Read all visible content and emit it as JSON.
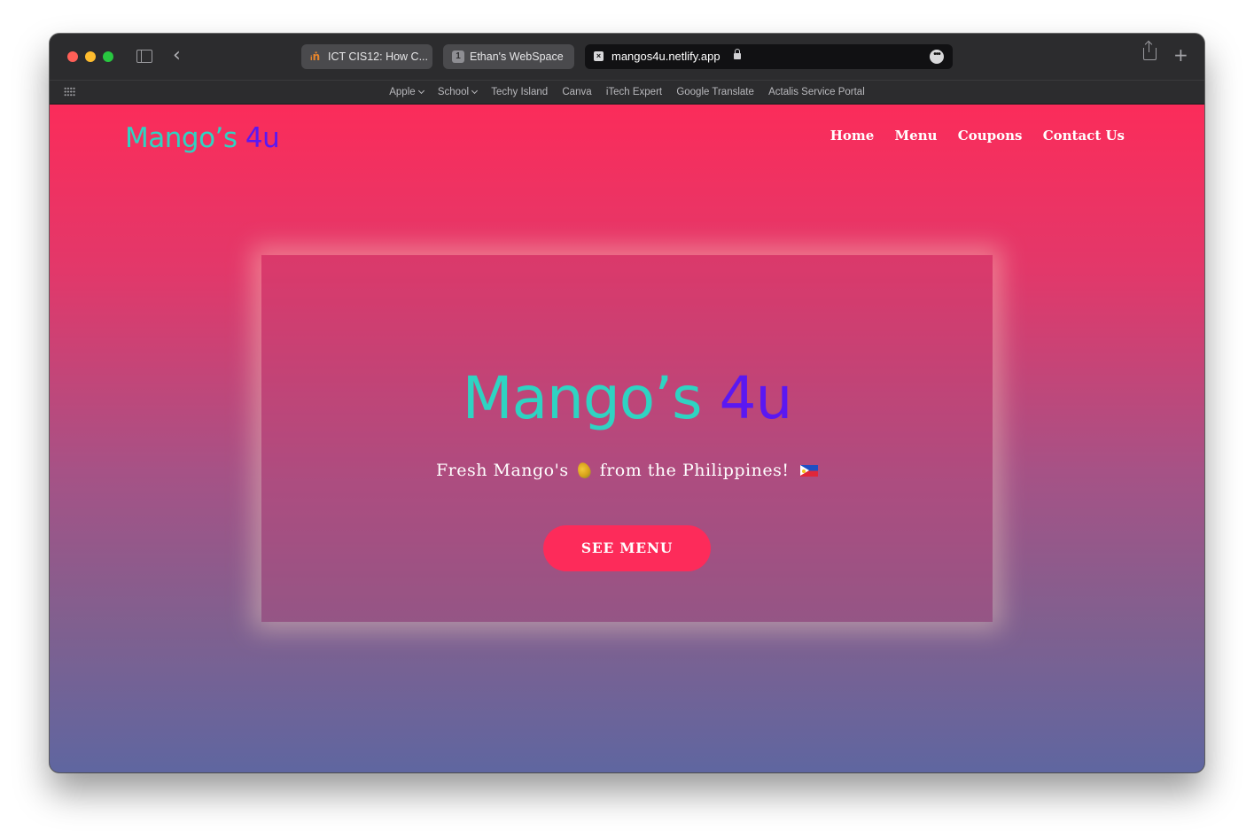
{
  "browser": {
    "tabs": [
      {
        "label": "ICT CIS12: How C...",
        "favicon": "moodle-icon"
      },
      {
        "label": "Ethan's WebSpace",
        "favicon": "tab-group-icon",
        "favicon_text": "1"
      }
    ],
    "address": {
      "url": "mangos4u.netlify.app",
      "secure": true
    },
    "bookmarks": [
      {
        "label": "Apple",
        "has_menu": true
      },
      {
        "label": "School",
        "has_menu": true
      },
      {
        "label": "Techy Island"
      },
      {
        "label": "Canva"
      },
      {
        "label": "iTech Expert"
      },
      {
        "label": "Google Translate"
      },
      {
        "label": "Actalis Service Portal"
      }
    ]
  },
  "site": {
    "logo": {
      "part1": "Mango’s",
      "part2": "4u"
    },
    "nav": [
      "Home",
      "Menu",
      "Coupons",
      "Contact Us"
    ],
    "hero": {
      "title_part1": "Mango’s",
      "title_part2": "4u",
      "subtitle_before": "Fresh Mango's",
      "subtitle_after": "from the Philippines!",
      "cta_label": "SEE MENU"
    }
  },
  "colors": {
    "brand_teal": "#2fd3c2",
    "brand_purple": "#5a18f2",
    "accent_pink": "#fd2b5a",
    "gradient_top": "#fb2c5a",
    "gradient_bottom": "#5f66a0"
  }
}
